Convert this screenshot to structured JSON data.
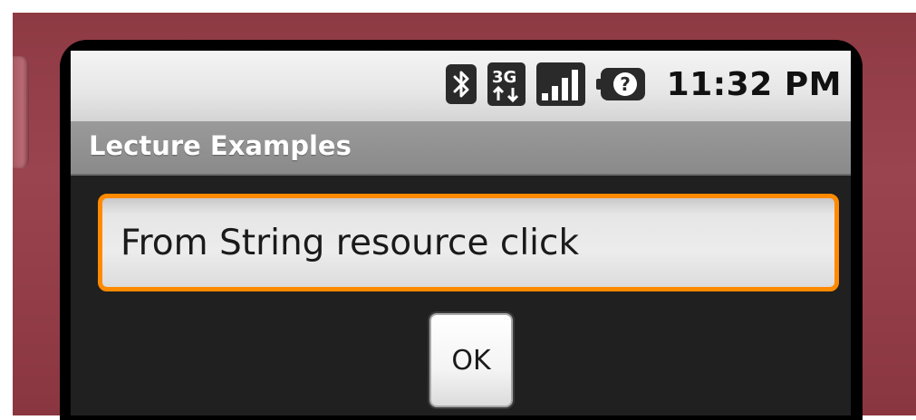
{
  "status_bar": {
    "time": "11:32 PM",
    "icons": [
      "bluetooth-icon",
      "3g-data-icon",
      "signal-strength-icon",
      "battery-unknown-icon"
    ],
    "battery_unknown_glyph": "?",
    "network_label": "3G"
  },
  "app": {
    "title": "Lecture Examples"
  },
  "main": {
    "input_value": "From String resource click",
    "ok_button_label": "OK"
  },
  "colors": {
    "focus_border": "#ff8a00",
    "device_frame": "#8e3a43",
    "screen_background": "#202020",
    "title_bar": "#8f8f8f"
  }
}
